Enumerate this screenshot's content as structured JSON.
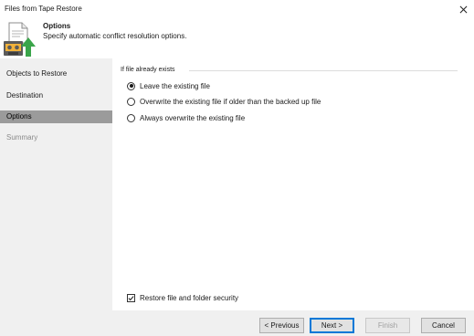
{
  "window": {
    "title": "Files from Tape Restore",
    "close_label": "×"
  },
  "header": {
    "icon": "tape-restore-icon",
    "title": "Options",
    "subtitle": "Specify automatic conflict resolution options."
  },
  "nav": {
    "items": [
      {
        "label": "Objects to Restore",
        "state": "normal"
      },
      {
        "label": "Destination",
        "state": "normal"
      },
      {
        "label": "Options",
        "state": "active"
      },
      {
        "label": "Summary",
        "state": "disabled"
      }
    ]
  },
  "options": {
    "group_label": "If file already exists",
    "radios": [
      {
        "label": "Leave the existing file",
        "checked": true
      },
      {
        "label": "Overwrite the existing file if older than the backed up file",
        "checked": false
      },
      {
        "label": "Always overwrite the existing file",
        "checked": false
      }
    ],
    "security_checkbox": {
      "label": "Restore file and folder security",
      "checked": true
    }
  },
  "footer": {
    "previous_label": "< Previous",
    "next_label": "Next >",
    "finish_label": "Finish",
    "cancel_label": "Cancel"
  },
  "colors": {
    "nav_background": "#f0f0f0",
    "nav_active": "#9b9b9b",
    "focus_border": "#0078d7",
    "restore_arrow": "#3aa54a"
  }
}
